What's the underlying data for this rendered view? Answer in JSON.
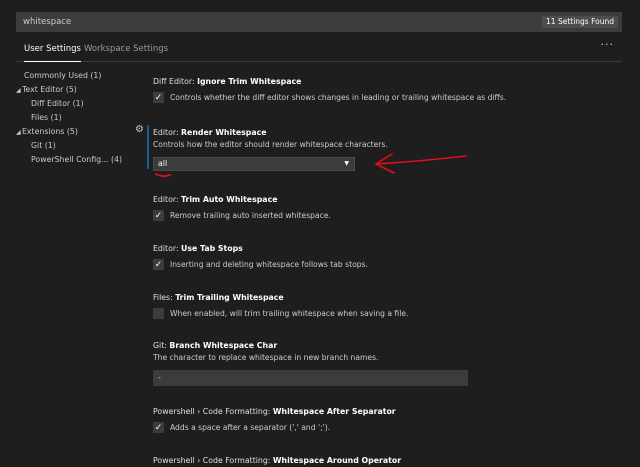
{
  "search": {
    "value": "whitespace",
    "count": "11 Settings Found"
  },
  "tabs": [
    {
      "label": "User Settings"
    },
    {
      "label": "Workspace Settings"
    }
  ],
  "more_label": "···",
  "toc": [
    {
      "label": "Commonly Used (1)",
      "expanded": null
    },
    {
      "label": "Text Editor (5)",
      "expanded": true
    },
    {
      "label": "Diff Editor (1)",
      "expanded": null
    },
    {
      "label": "Files (1)",
      "expanded": null
    },
    {
      "label": "Extensions (5)",
      "expanded": true
    },
    {
      "label": "Git (1)",
      "expanded": null
    },
    {
      "label": "PowerShell Config... (4)",
      "expanded": null
    }
  ],
  "settings": [
    {
      "category": "Diff Editor: ",
      "name": "Ignore Trim Whitespace",
      "checked": true,
      "label": "Controls whether the diff editor shows changes in leading or trailing whitespace as diffs."
    },
    {
      "category": "Editor: ",
      "name": "Render Whitespace",
      "desc": "Controls how the editor should render whitespace characters.",
      "select_value": "all"
    },
    {
      "category": "Editor: ",
      "name": "Trim Auto Whitespace",
      "checked": true,
      "label": "Remove trailing auto inserted whitespace."
    },
    {
      "category": "Editor: ",
      "name": "Use Tab Stops",
      "checked": true,
      "label": "Inserting and deleting whitespace follows tab stops."
    },
    {
      "category": "Files: ",
      "name": "Trim Trailing Whitespace",
      "checked": false,
      "label": "When enabled, will trim trailing whitespace when saving a file."
    },
    {
      "category": "Git: ",
      "name": "Branch Whitespace Char",
      "desc": "The character to replace whitespace in new branch names.",
      "input_value": "-"
    },
    {
      "category": "Powershell › Code Formatting: ",
      "name": "Whitespace After Separator",
      "checked": true,
      "label": "Adds a space after a separator (',' and ';')."
    },
    {
      "category": "Powershell › Code Formatting: ",
      "name": "Whitespace Around Operator"
    }
  ],
  "icons": {
    "check": "✓",
    "gear": "⚙",
    "dropdown": "▼",
    "expanded_arrow": "◢"
  },
  "colors": {
    "accent": "#0e639c",
    "annotation": "#e0101a"
  }
}
